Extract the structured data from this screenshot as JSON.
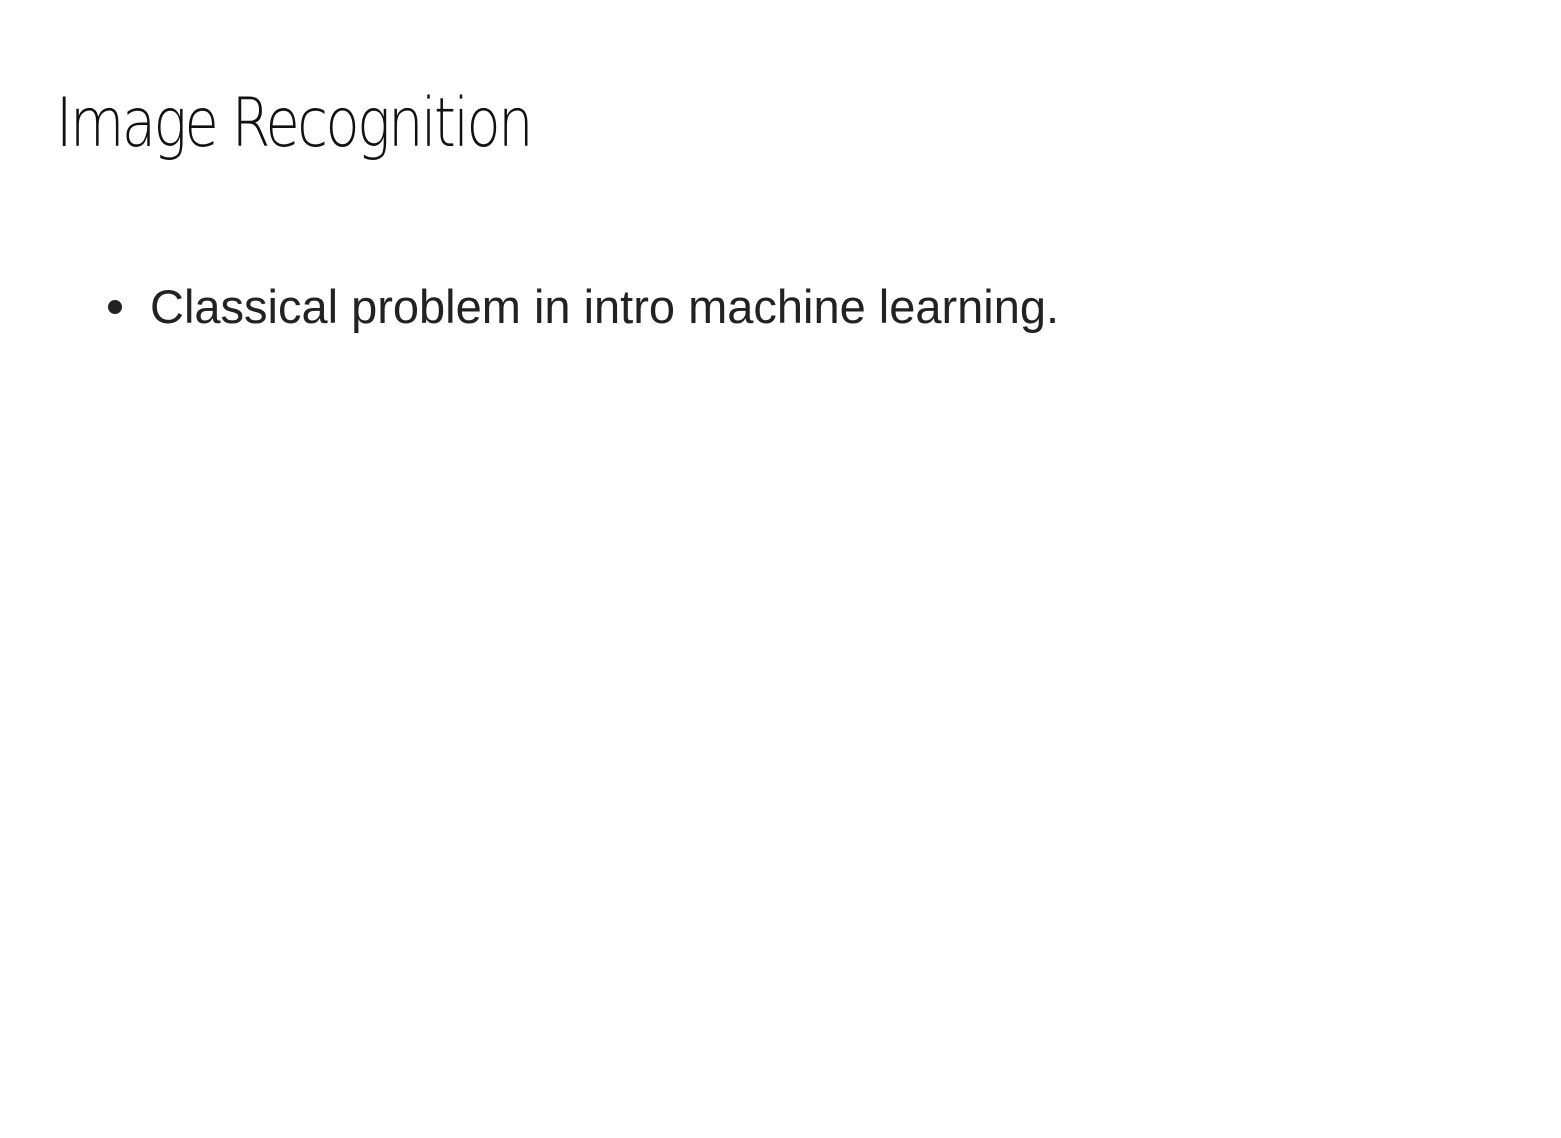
{
  "slide": {
    "title": "Image Recognition",
    "bullets": [
      "Classical problem in intro machine learning."
    ]
  }
}
